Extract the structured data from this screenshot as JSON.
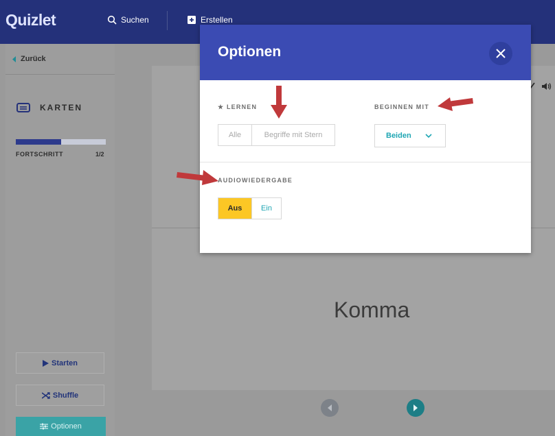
{
  "app": {
    "logo": "Quizlet"
  },
  "header": {
    "search_label": "Suchen",
    "create_label": "Erstellen"
  },
  "sidebar": {
    "back_label": "Zurück",
    "mode_label": "KARTEN",
    "progress_label": "FORTSCHRITT",
    "progress_count": "1/2",
    "progress_fraction": 0.5,
    "start_label": "Starten",
    "shuffle_label": "Shuffle",
    "options_label": "Optionen"
  },
  "card": {
    "term": "Komma"
  },
  "modal": {
    "title": "Optionen",
    "learn": {
      "label": "★ LERNEN",
      "options": [
        "Alle",
        "Begriffe mit Stern"
      ]
    },
    "start_with": {
      "label": "BEGINNEN MIT",
      "selected": "Beiden"
    },
    "audio": {
      "label": "AUDIOWIEDERGABE",
      "options": [
        "Aus",
        "Ein"
      ],
      "selected": "Aus"
    }
  },
  "colors": {
    "header": "#24317a",
    "modal_header": "#3b4bb3",
    "accent_teal": "#1fa6b3",
    "toggle_active": "#fcc725",
    "annotation_arrow": "#c0393b"
  }
}
